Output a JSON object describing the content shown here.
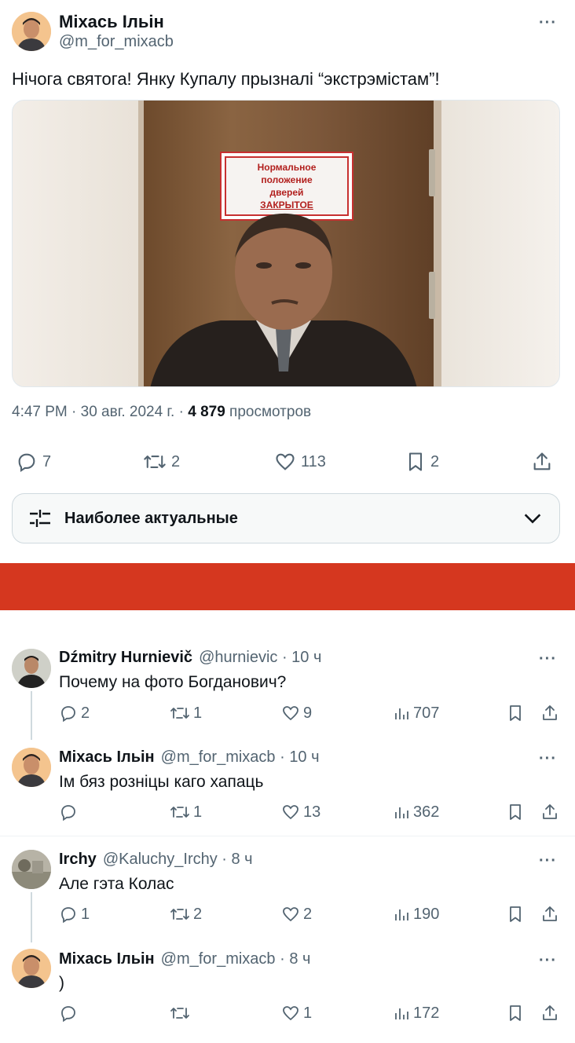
{
  "main_tweet": {
    "name": "Міхась Ільін",
    "handle": "@m_for_mixacb",
    "text": "Нічога святога! Янку Купалу прызналі “экстрэмістам”!",
    "image_sign_lines": [
      "Нормальное",
      "положение",
      "дверей",
      "ЗАКРЫТОЕ"
    ],
    "time": "4:47 PM · 30 авг. 2024 г. ·",
    "views": "4 879",
    "views_label": "просмотров",
    "replies": "7",
    "retweets": "2",
    "likes": "113",
    "bookmarks": "2"
  },
  "sort_dropdown": {
    "label": "Наиболее актуальные"
  },
  "replies": [
    {
      "name": "Dźmitry Hurnievič",
      "handle": "@hurnievic · 10 ч",
      "text": "Почему на фото Богданович?",
      "replies": "2",
      "retweets": "1",
      "likes": "9",
      "views": "707"
    },
    {
      "name": "Міхась Ільін",
      "handle": "@m_for_mixacb · 10 ч",
      "text": "Ім бяз розніцы каго хапаць",
      "replies": "",
      "retweets": "1",
      "likes": "13",
      "views": "362"
    },
    {
      "name": "Irchy",
      "handle": "@Kaluchy_Irchy · 8 ч",
      "text": "Але гэта Колас",
      "replies": "1",
      "retweets": "2",
      "likes": "2",
      "views": "190"
    },
    {
      "name": "Міхась Ільін",
      "handle": "@m_for_mixacb · 8 ч",
      "text": ")",
      "replies": "",
      "retweets": "",
      "likes": "1",
      "views": "172"
    }
  ],
  "colors": {
    "accent_red": "#d5371f",
    "text_secondary": "#536471",
    "text_primary": "#0f1419"
  }
}
